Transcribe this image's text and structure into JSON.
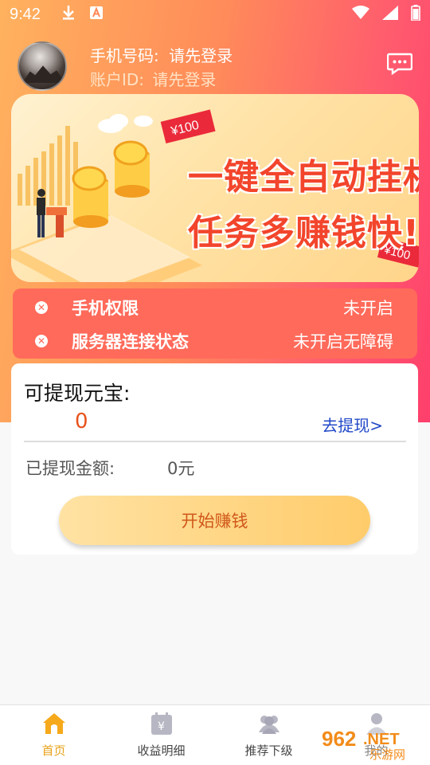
{
  "status_bar": {
    "time": "9:42",
    "icons": [
      "download-icon",
      "a-badge-icon",
      "wifi-icon",
      "signal-icon",
      "battery-icon"
    ]
  },
  "profile": {
    "phone_label": "手机号码:",
    "phone_value": "请先登录",
    "account_label": "账户ID:",
    "account_value": "请先登录"
  },
  "banner": {
    "line1": "一键全自动挂机",
    "line2": "任务多赚钱快!",
    "tag1": "¥100",
    "tag2": "¥100"
  },
  "permissions": [
    {
      "label": "手机权限",
      "status": "未开启"
    },
    {
      "label": "服务器连接状态",
      "status": "未开启无障碍"
    }
  ],
  "withdraw": {
    "title": "可提现元宝:",
    "amount": "0",
    "link": "去提现>",
    "withdrawn_label": "已提现金额:",
    "withdrawn_value": "0元",
    "start_button": "开始赚钱"
  },
  "nav": [
    {
      "label": "首页",
      "icon": "home-icon",
      "active": true
    },
    {
      "label": "收益明细",
      "icon": "calendar-yen-icon",
      "active": false
    },
    {
      "label": "推荐下级",
      "icon": "users-icon",
      "active": false
    },
    {
      "label": "我的",
      "icon": "user-icon",
      "active": false
    }
  ],
  "watermark": {
    "text1": "962",
    "text2": ".NET",
    "text3": "乐游网"
  },
  "colors": {
    "accent_orange": "#ffb25e",
    "accent_pink": "#ff3f6c",
    "status_card": "#ff6a5a",
    "amount": "#e8531c",
    "link": "#2048c8",
    "nav_active": "#e8a21a"
  }
}
